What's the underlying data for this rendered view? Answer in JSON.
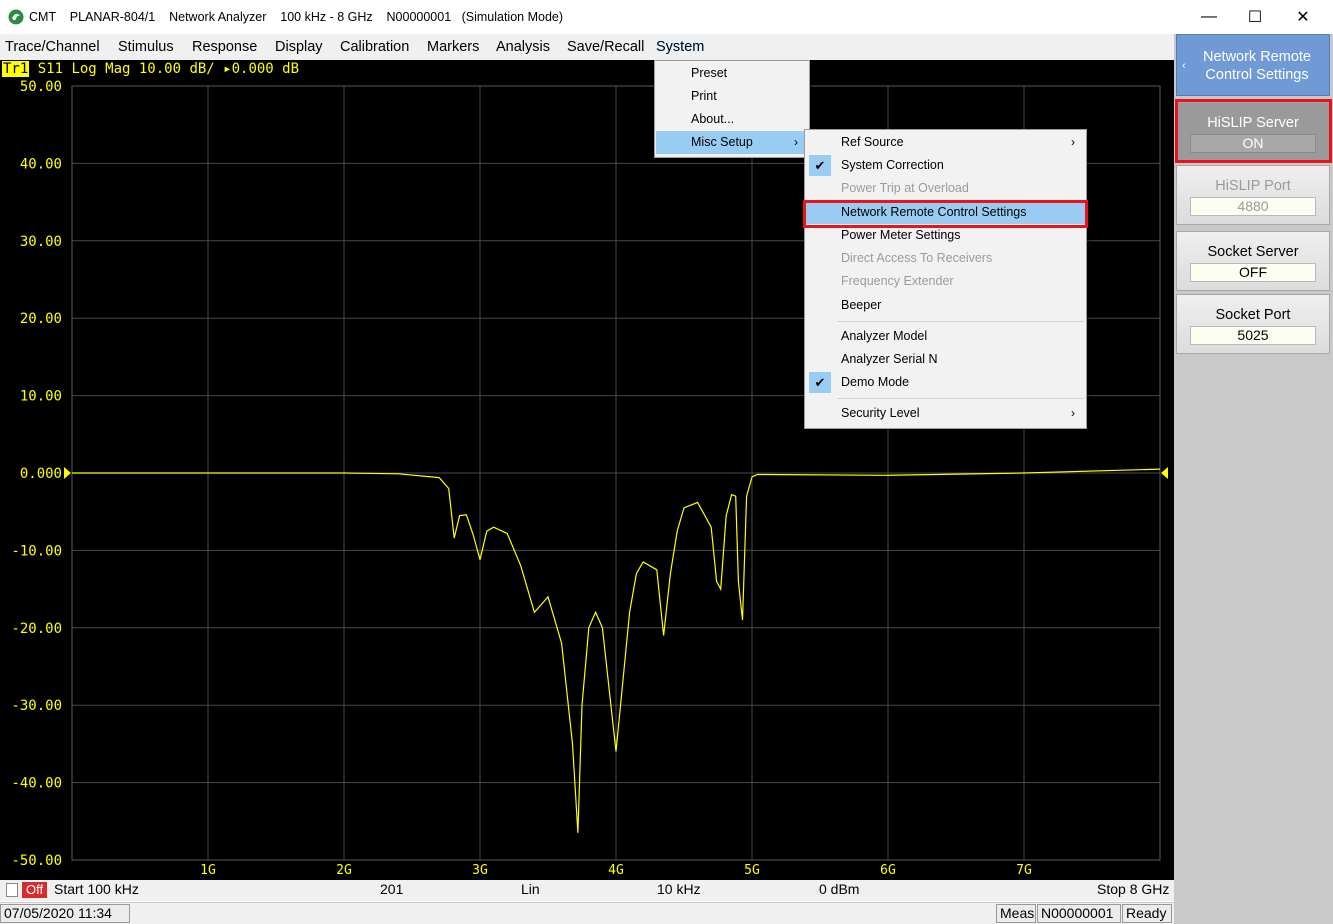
{
  "window": {
    "title": "CMT    PLANAR-804/1    Network Analyzer    100 kHz - 8 GHz    N00000001   (Simulation Mode)",
    "minimize_glyph": "—",
    "maximize_glyph": "☐",
    "close_glyph": "✕"
  },
  "menubar": {
    "items": [
      "Trace/Channel",
      "Stimulus",
      "Response",
      "Display",
      "Calibration",
      "Markers",
      "Analysis",
      "Save/Recall",
      "System"
    ]
  },
  "trace": {
    "tag": "Tr1",
    "header": " S11 Log Mag 10.00 dB/ ▸0.000 dB"
  },
  "chart_data": {
    "type": "line",
    "title": "",
    "ylabel": "",
    "xlabel": "",
    "x_unit": "GHz",
    "xlim": [
      0.0001,
      8
    ],
    "ylim": [
      -50,
      50
    ],
    "y_ticks": [
      "50.00",
      "40.00",
      "30.00",
      "20.00",
      "10.00",
      "0.000",
      "-10.00",
      "-20.00",
      "-30.00",
      "-40.00",
      "-50.00"
    ],
    "x_ticks": [
      "1G",
      "2G",
      "3G",
      "4G",
      "5G",
      "6G",
      "7G"
    ],
    "grid": true,
    "series": [
      {
        "color": "#ffff00",
        "x": [
          0.0001,
          1.0,
          2.0,
          2.4,
          2.7,
          2.77,
          2.81,
          2.85,
          2.9,
          2.95,
          3.0,
          3.05,
          3.1,
          3.2,
          3.3,
          3.4,
          3.45,
          3.5,
          3.6,
          3.68,
          3.72,
          3.75,
          3.8,
          3.85,
          3.9,
          4.0,
          4.05,
          4.1,
          4.15,
          4.2,
          4.3,
          4.35,
          4.4,
          4.45,
          4.5,
          4.6,
          4.7,
          4.74,
          4.77,
          4.81,
          4.85,
          4.88,
          4.9,
          4.93,
          4.96,
          5.0,
          5.04,
          5.1,
          6.0,
          7.0,
          8.0
        ],
        "y": [
          0.0,
          0.0,
          0.0,
          -0.1,
          -0.6,
          -2.0,
          -8.4,
          -5.5,
          -5.4,
          -8.0,
          -11.2,
          -7.5,
          -7.0,
          -7.8,
          -12.0,
          -18.0,
          -17.0,
          -16.0,
          -22.0,
          -35.0,
          -46.5,
          -30.0,
          -20.0,
          -18.0,
          -20.0,
          -36.0,
          -27.0,
          -18.0,
          -13.0,
          -11.5,
          -12.5,
          -21.0,
          -13.0,
          -7.5,
          -4.5,
          -3.8,
          -7.0,
          -14.0,
          -15.0,
          -5.5,
          -2.8,
          -3.0,
          -14.0,
          -19.0,
          -3.0,
          -0.5,
          -0.2,
          -0.2,
          -0.3,
          0.0,
          0.5
        ]
      }
    ]
  },
  "bottom": {
    "off_label": "Off",
    "start": "Start 100 kHz",
    "points": "201",
    "sweep_type": "Lin",
    "ifbw": "10 kHz",
    "power": "0 dBm",
    "stop": "Stop 8 GHz",
    "datetime": "07/05/2020 11:34",
    "meas": "Meas",
    "serial": "N00000001",
    "ready": "Ready"
  },
  "system_menu": {
    "items": [
      {
        "label": "Preset"
      },
      {
        "label": "Print"
      },
      {
        "label": "About..."
      },
      {
        "label": "Misc Setup",
        "arrow": "›"
      }
    ]
  },
  "misc_menu": {
    "items": [
      {
        "label": "Ref Source",
        "arrow": "›"
      },
      {
        "label": "System Correction",
        "check": "✔"
      },
      {
        "label": "Power Trip at Overload"
      },
      {
        "label": "Network Remote Control Settings"
      },
      {
        "label": "Power Meter Settings"
      },
      {
        "label": "Direct Access To Receivers"
      },
      {
        "label": "Frequency Extender"
      },
      {
        "label": "Beeper"
      },
      {
        "label": "Analyzer Model"
      },
      {
        "label": "Analyzer Serial N"
      },
      {
        "label": "Demo Mode",
        "check": "✔"
      },
      {
        "label": "Security Level",
        "arrow": "›"
      }
    ]
  },
  "softkeys": {
    "header": "Network Remote Control Settings",
    "back_glyph": "‹",
    "hislip_server": {
      "label": "HiSLIP Server",
      "value": "ON"
    },
    "hislip_port": {
      "label": "HiSLIP Port",
      "value": "4880"
    },
    "socket_server": {
      "label": "Socket Server",
      "value": "OFF"
    },
    "socket_port": {
      "label": "Socket Port",
      "value": "5025"
    }
  }
}
